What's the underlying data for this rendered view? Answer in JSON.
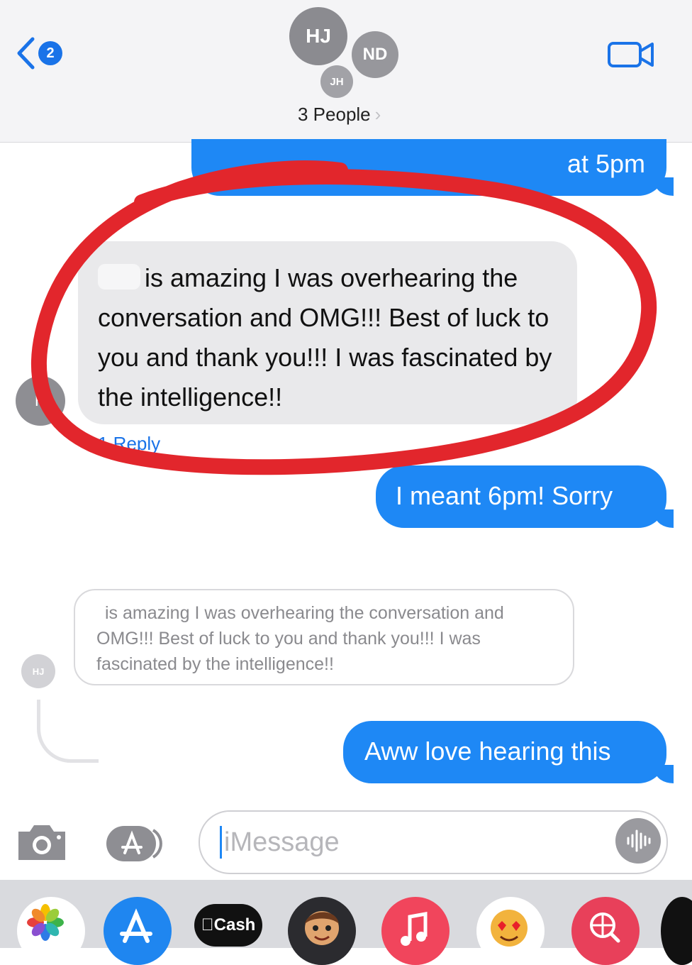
{
  "header": {
    "back_count": "2",
    "avatars": [
      "HJ",
      "ND",
      "JH"
    ],
    "group_label": "3 People"
  },
  "messages": {
    "top_partial": "at 5pm",
    "incoming_body": "is amazing I was overhearing the conversation and OMG!!! Best of luck to you and thank you!!! I was fascinated by the intelligence!!",
    "incoming_avatar": "H",
    "reply_count": "1 Reply",
    "correction": "I meant 6pm! Sorry",
    "quoted_body": "is amazing I was overhearing the conversation and OMG!!! Best of luck to you and thank you!!! I was fascinated by the intelligence!!",
    "quoted_avatar": "HJ",
    "reply": "Aww love hearing this"
  },
  "composer": {
    "placeholder": "iMessage"
  },
  "app_tray": {
    "items": [
      "photos-app",
      "app-store",
      "cash-app",
      "memoji",
      "music-app",
      "sticker-app",
      "image-search-app",
      "more-app"
    ],
    "cash_label": "Cash"
  },
  "colors": {
    "outgoing_bubble": "#1e88f5",
    "incoming_bubble": "#e9e9eb",
    "annotation_red": "#e2262c"
  }
}
